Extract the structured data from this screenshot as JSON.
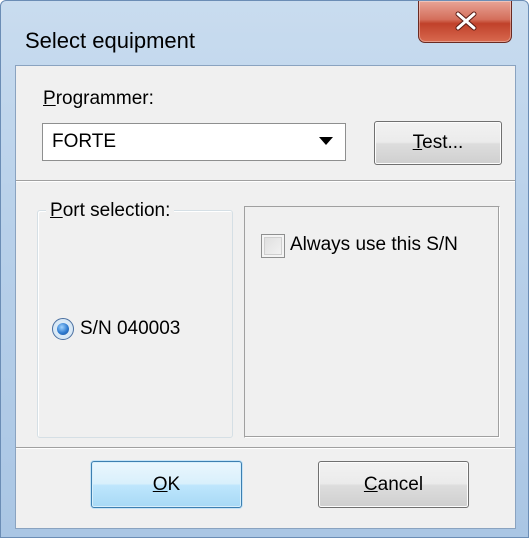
{
  "window": {
    "title": "Select equipment"
  },
  "programmer": {
    "label_first": "P",
    "label_rest": "rogrammer:",
    "selected": "FORTE"
  },
  "buttons": {
    "test_first": "T",
    "test_rest": "est...",
    "ok_first": "O",
    "ok_rest": "K",
    "cancel_first": "C",
    "cancel_rest": "ancel"
  },
  "port_selection": {
    "label_first": "P",
    "label_rest": "ort selection:",
    "port_option": "S/N 040003",
    "port_selected": true
  },
  "options": {
    "always_use_sn": "Always use this S/N",
    "always_use_sn_checked": false
  },
  "icons": {
    "close": "close-icon",
    "dropdown": "chevron-down-icon"
  }
}
